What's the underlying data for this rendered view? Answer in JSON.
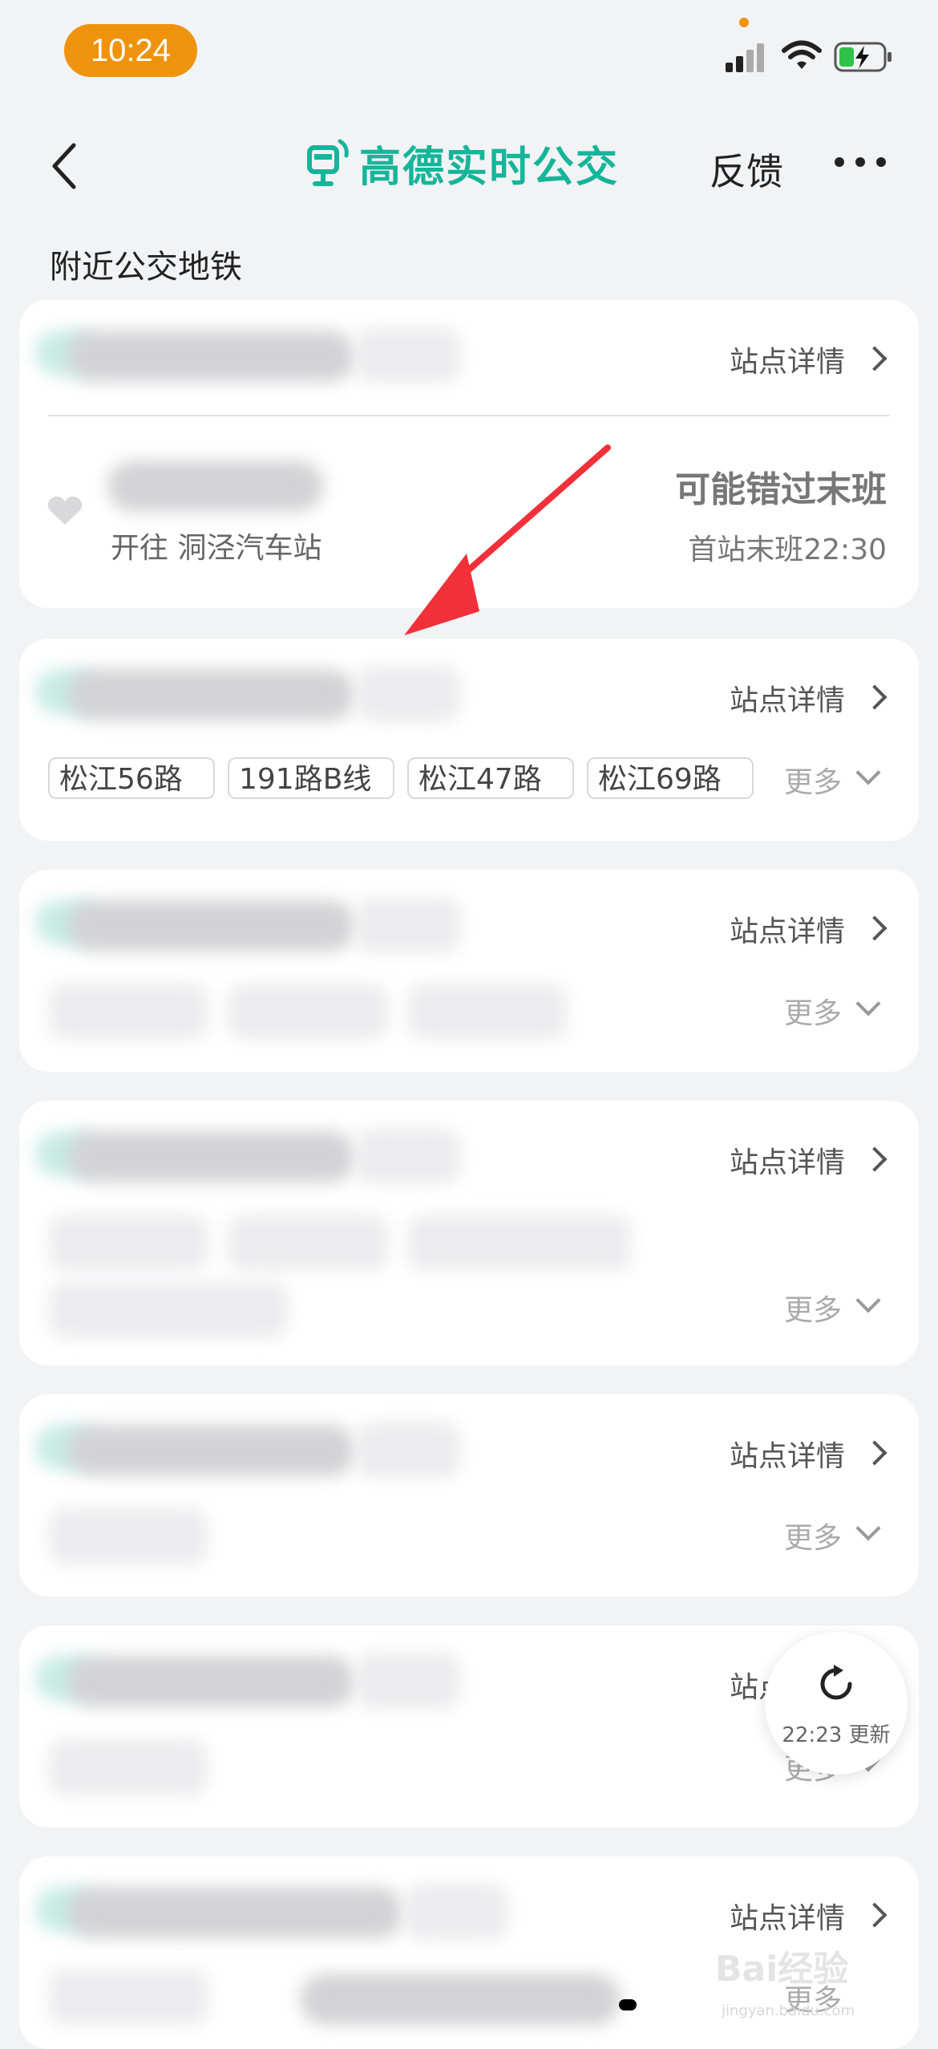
{
  "status_bar": {
    "time": "10:24"
  },
  "nav": {
    "title": "高德实时公交",
    "feedback": "反馈"
  },
  "section_title": "附近公交地铁",
  "cards": [
    {
      "detail": "站点详情",
      "destination": "开往 洞泾汽车站",
      "warning": "可能错过末班",
      "last_bus": "首站末班22:30"
    },
    {
      "detail": "站点详情",
      "chips": [
        "松江56路",
        "191路B线",
        "松江47路",
        "松江69路"
      ],
      "more": "更多"
    },
    {
      "detail": "站点详情",
      "more": "更多"
    },
    {
      "detail": "站点详情",
      "more": "更多"
    },
    {
      "detail": "站点详情",
      "more": "更多"
    },
    {
      "detail": "站点详情",
      "more": "更多"
    },
    {
      "detail": "站点详情",
      "more": "更多"
    }
  ],
  "refresh": {
    "time_text": "22:23 更新"
  },
  "watermark": {
    "text": "Bai经验",
    "sub": "jingyan.baidu.com"
  },
  "colors": {
    "accent": "#15b59a",
    "status": "#f0930c",
    "arrow": "#f2303a"
  }
}
